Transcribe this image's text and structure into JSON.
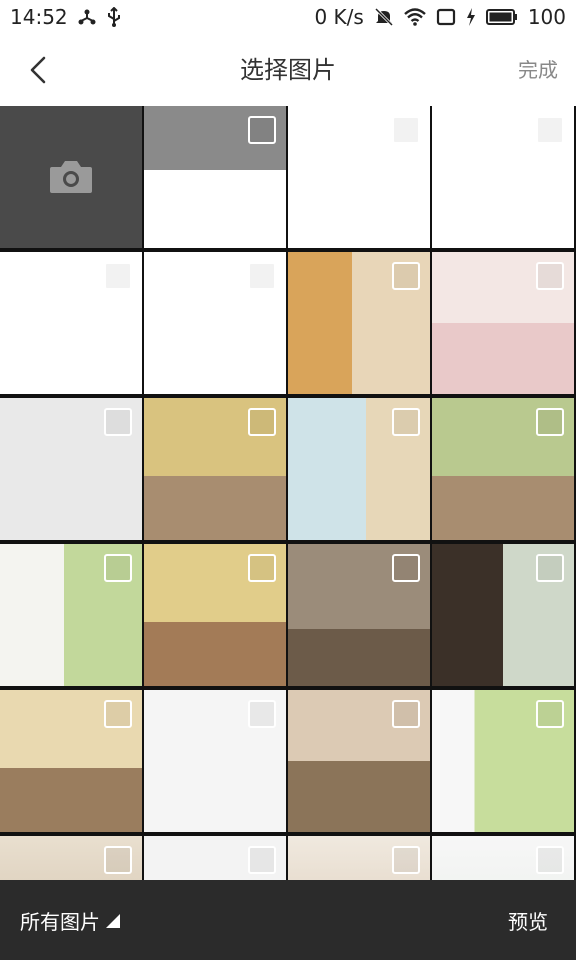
{
  "status_bar": {
    "time": "14:52",
    "network_speed": "0 K/s",
    "battery": "100"
  },
  "header": {
    "title": "选择图片",
    "done_label": "完成"
  },
  "grid": {
    "columns": 4,
    "cells": [
      {
        "kind": "camera",
        "icon": "camera-icon"
      },
      {
        "kind": "photo",
        "style": "p-screen-a"
      },
      {
        "kind": "photo",
        "style": "p-listing"
      },
      {
        "kind": "photo",
        "style": "p-profile"
      },
      {
        "kind": "photo",
        "style": "p-appgrid"
      },
      {
        "kind": "photo",
        "style": "p-appgrid"
      },
      {
        "kind": "photo",
        "style": "p-room-orange"
      },
      {
        "kind": "photo",
        "style": "p-room-pink"
      },
      {
        "kind": "photo",
        "style": "p-doc"
      },
      {
        "kind": "photo",
        "style": "p-room-yellow"
      },
      {
        "kind": "photo",
        "style": "p-room-window"
      },
      {
        "kind": "photo",
        "style": "p-room-green"
      },
      {
        "kind": "photo",
        "style": "p-room-white"
      },
      {
        "kind": "photo",
        "style": "p-room-yellow2"
      },
      {
        "kind": "photo",
        "style": "p-sofa"
      },
      {
        "kind": "photo",
        "style": "p-room-dark"
      },
      {
        "kind": "photo",
        "style": "p-bedroom"
      },
      {
        "kind": "photo",
        "style": "p-bath"
      },
      {
        "kind": "photo",
        "style": "p-bed-beige"
      },
      {
        "kind": "photo",
        "style": "p-room-green2"
      },
      {
        "kind": "photo",
        "style": "p-row-a"
      },
      {
        "kind": "photo",
        "style": "p-poster"
      },
      {
        "kind": "photo",
        "style": "p-row-c"
      },
      {
        "kind": "photo",
        "style": "p-row-d"
      }
    ]
  },
  "bottom_bar": {
    "album_label": "所有图片",
    "preview_label": "预览"
  },
  "colors": {
    "bottom_bar_bg": "#2b2b2b",
    "header_bg": "#ffffff",
    "title_text": "#333333",
    "done_text": "#888888"
  }
}
